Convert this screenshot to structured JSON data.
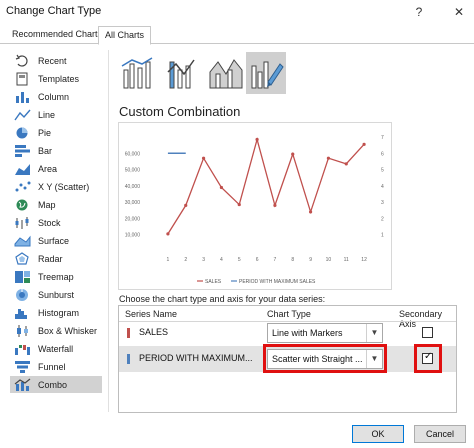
{
  "window": {
    "title": "Change Chart Type",
    "help_glyph": "?",
    "close_glyph": "✕"
  },
  "tabs": [
    {
      "label": "Recommended Charts",
      "active": false
    },
    {
      "label": "All Charts",
      "active": true
    }
  ],
  "categories": [
    {
      "label": "Recent",
      "icon": "recent-icon"
    },
    {
      "label": "Templates",
      "icon": "templates-icon"
    },
    {
      "label": "Column",
      "icon": "column-chart-icon"
    },
    {
      "label": "Line",
      "icon": "line-chart-icon"
    },
    {
      "label": "Pie",
      "icon": "pie-chart-icon"
    },
    {
      "label": "Bar",
      "icon": "bar-chart-icon"
    },
    {
      "label": "Area",
      "icon": "area-chart-icon"
    },
    {
      "label": "X Y (Scatter)",
      "icon": "scatter-chart-icon"
    },
    {
      "label": "Map",
      "icon": "map-chart-icon"
    },
    {
      "label": "Stock",
      "icon": "stock-chart-icon"
    },
    {
      "label": "Surface",
      "icon": "surface-chart-icon"
    },
    {
      "label": "Radar",
      "icon": "radar-chart-icon"
    },
    {
      "label": "Treemap",
      "icon": "treemap-chart-icon"
    },
    {
      "label": "Sunburst",
      "icon": "sunburst-chart-icon"
    },
    {
      "label": "Histogram",
      "icon": "histogram-chart-icon"
    },
    {
      "label": "Box & Whisker",
      "icon": "box-whisker-chart-icon"
    },
    {
      "label": "Waterfall",
      "icon": "waterfall-chart-icon"
    },
    {
      "label": "Funnel",
      "icon": "funnel-chart-icon"
    },
    {
      "label": "Combo",
      "icon": "combo-chart-icon",
      "selected": true
    }
  ],
  "subtypes": [
    {
      "name": "clustered-column-line",
      "selected": false
    },
    {
      "name": "clustered-column-line-secondary-axis",
      "selected": false
    },
    {
      "name": "stacked-area-clustered-column",
      "selected": false
    },
    {
      "name": "custom-combination",
      "selected": true
    }
  ],
  "heading": "Custom Combination",
  "preview_chart": {
    "chart_data": {
      "type": "line",
      "x": [
        1,
        2,
        3,
        4,
        5,
        6,
        7,
        8,
        9,
        10,
        11,
        12
      ],
      "series": [
        {
          "name": "SALES",
          "axis": "primary",
          "color": "#c0504d",
          "values": [
            10500,
            28000,
            57000,
            39000,
            28500,
            68500,
            28000,
            59500,
            24000,
            57000,
            53500,
            65500
          ]
        },
        {
          "name": "PERIOD WITH MAXIMUM SALES",
          "axis": "secondary",
          "color": "#4f81bd",
          "points": [
            [
              1,
              6
            ],
            [
              2,
              6
            ]
          ]
        }
      ],
      "y_ticks": [
        "10,000",
        "20,000",
        "30,000",
        "40,000",
        "50,000",
        "60,000"
      ],
      "y2_ticks": [
        "1",
        "2",
        "3",
        "4",
        "5",
        "6",
        "7"
      ],
      "x_ticks": [
        "1",
        "2",
        "3",
        "4",
        "5",
        "6",
        "7",
        "8",
        "9",
        "10",
        "11",
        "12"
      ],
      "ylim": [
        0,
        70000
      ],
      "y2lim": [
        0,
        7
      ],
      "legend_position": "bottom"
    }
  },
  "series_section": {
    "instruction": "Choose the chart type and axis for your data series:",
    "headers": {
      "name": "Series Name",
      "type": "Chart Type",
      "axis": "Secondary Axis"
    },
    "rows": [
      {
        "name": "SALES",
        "color": "#c0504d",
        "chart_type": "Line with Markers",
        "secondary_axis": false,
        "selected": false
      },
      {
        "name": "PERIOD WITH MAXIMUM...",
        "color": "#4f81bd",
        "chart_type": "Scatter with Straight ...",
        "secondary_axis": true,
        "selected": true
      }
    ]
  },
  "highlight_color": "#e01010",
  "buttons": {
    "ok": "OK",
    "cancel": "Cancel"
  }
}
